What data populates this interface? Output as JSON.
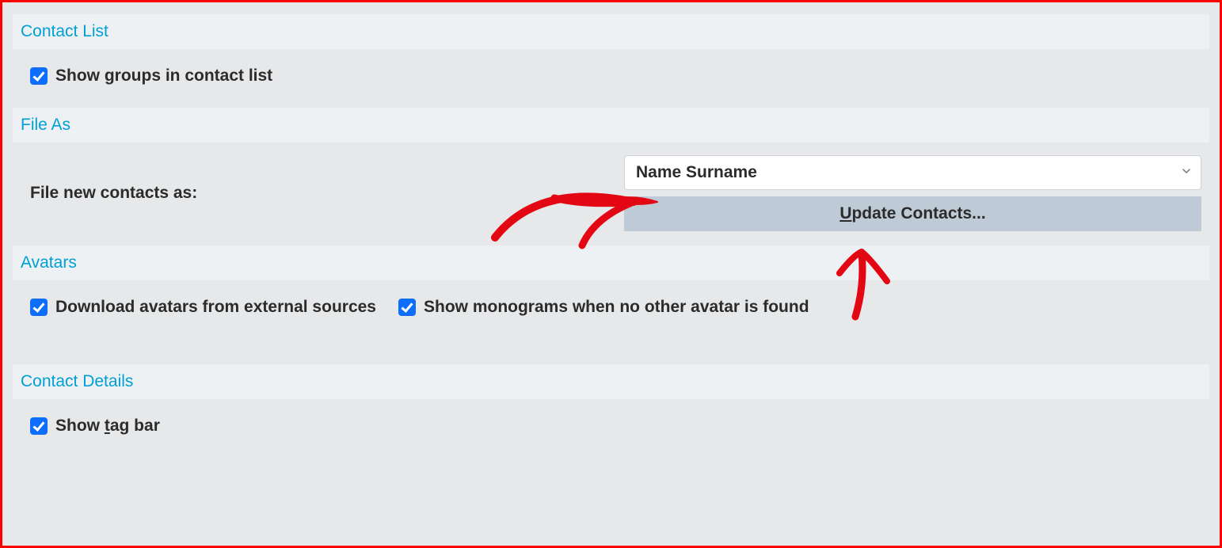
{
  "sections": {
    "contact_list": {
      "title": "Contact List",
      "show_groups_label": "Show groups in contact list",
      "show_groups_checked": true
    },
    "file_as": {
      "title": "File As",
      "label": "File new contacts as:",
      "selected_option": "Name Surname",
      "update_button_prefix": "U",
      "update_button_rest": "pdate Contacts...",
      "update_button_full": "Update Contacts..."
    },
    "avatars": {
      "title": "Avatars",
      "download_label": "Download avatars from external sources",
      "download_checked": true,
      "monograms_label": "Show monograms when no other avatar is found",
      "monograms_checked": true
    },
    "contact_details": {
      "title": "Contact Details",
      "show_tag_bar_prefix": "Show ",
      "show_tag_bar_underline": "t",
      "show_tag_bar_suffix": "ag bar",
      "show_tag_bar_checked": true
    }
  },
  "annotation_color": "#e30613"
}
